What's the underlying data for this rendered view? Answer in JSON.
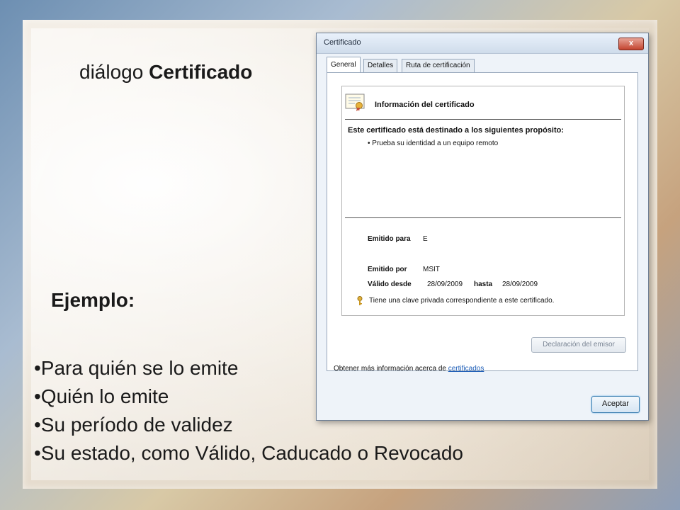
{
  "slide": {
    "title_prefix": "diálogo",
    "title_bold": "Certificado",
    "example_label": "Ejemplo:",
    "bullets": [
      "•Para quién se lo emite",
      "•Quién lo emite",
      "•Su período de validez",
      "•Su estado, como Válido, Caducado o Revocado"
    ]
  },
  "dialog": {
    "title": "Certificado",
    "close_label": "x",
    "tabs": [
      "General",
      "Detalles",
      "Ruta de certificación"
    ],
    "active_tab": "General",
    "info_title": "Información del certificado",
    "purpose_heading": "Este certificado está destinado a los siguientes propósito:",
    "purpose_items": [
      "• Prueba su identidad a un equipo remoto"
    ],
    "issued_to_label": "Emitido para",
    "issued_to_value": "E",
    "issued_by_label": "Emitido por",
    "issued_by_value": "MSIT",
    "valid_from_label": "Válido desde",
    "valid_from_value": "28/09/2009",
    "valid_to_label": "hasta",
    "valid_to_value": "28/09/2009",
    "private_key_text": "Tiene una clave privada correspondiente a este certificado.",
    "issuer_statement_button": "Declaración del emisor",
    "more_info_text": "Obtener más información acerca de ",
    "more_info_link": "certificados",
    "ok_button": "Aceptar"
  },
  "colors": {
    "link": "#1f5fb8",
    "close_button": "#c3442f"
  }
}
